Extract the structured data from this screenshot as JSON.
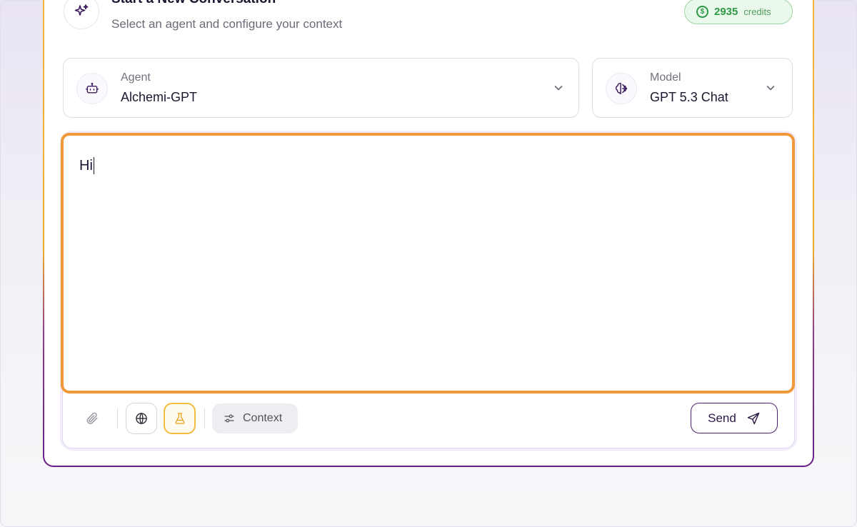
{
  "header": {
    "title": "Start a New Conversation",
    "subtitle": "Select an agent and configure your context",
    "credits_count": "2935",
    "credits_label": "credits"
  },
  "agent_select": {
    "label": "Agent",
    "value": "Alchemi-GPT",
    "icon": "robot-icon"
  },
  "model_select": {
    "label": "Model",
    "value": "GPT 5.3 Chat",
    "icon": "brain-icon"
  },
  "composer": {
    "text": "Hi",
    "toolbar": {
      "attach_icon": "paperclip-icon",
      "web_icon": "globe-icon",
      "lab_icon": "flask-icon",
      "context_label": "Context",
      "send_label": "Send"
    }
  },
  "colors": {
    "accent_purple": "#4b1e6e",
    "credits_green": "#2e9a44",
    "highlight_orange": "#f0993a",
    "flask_yellow": "#f3bd3c"
  }
}
